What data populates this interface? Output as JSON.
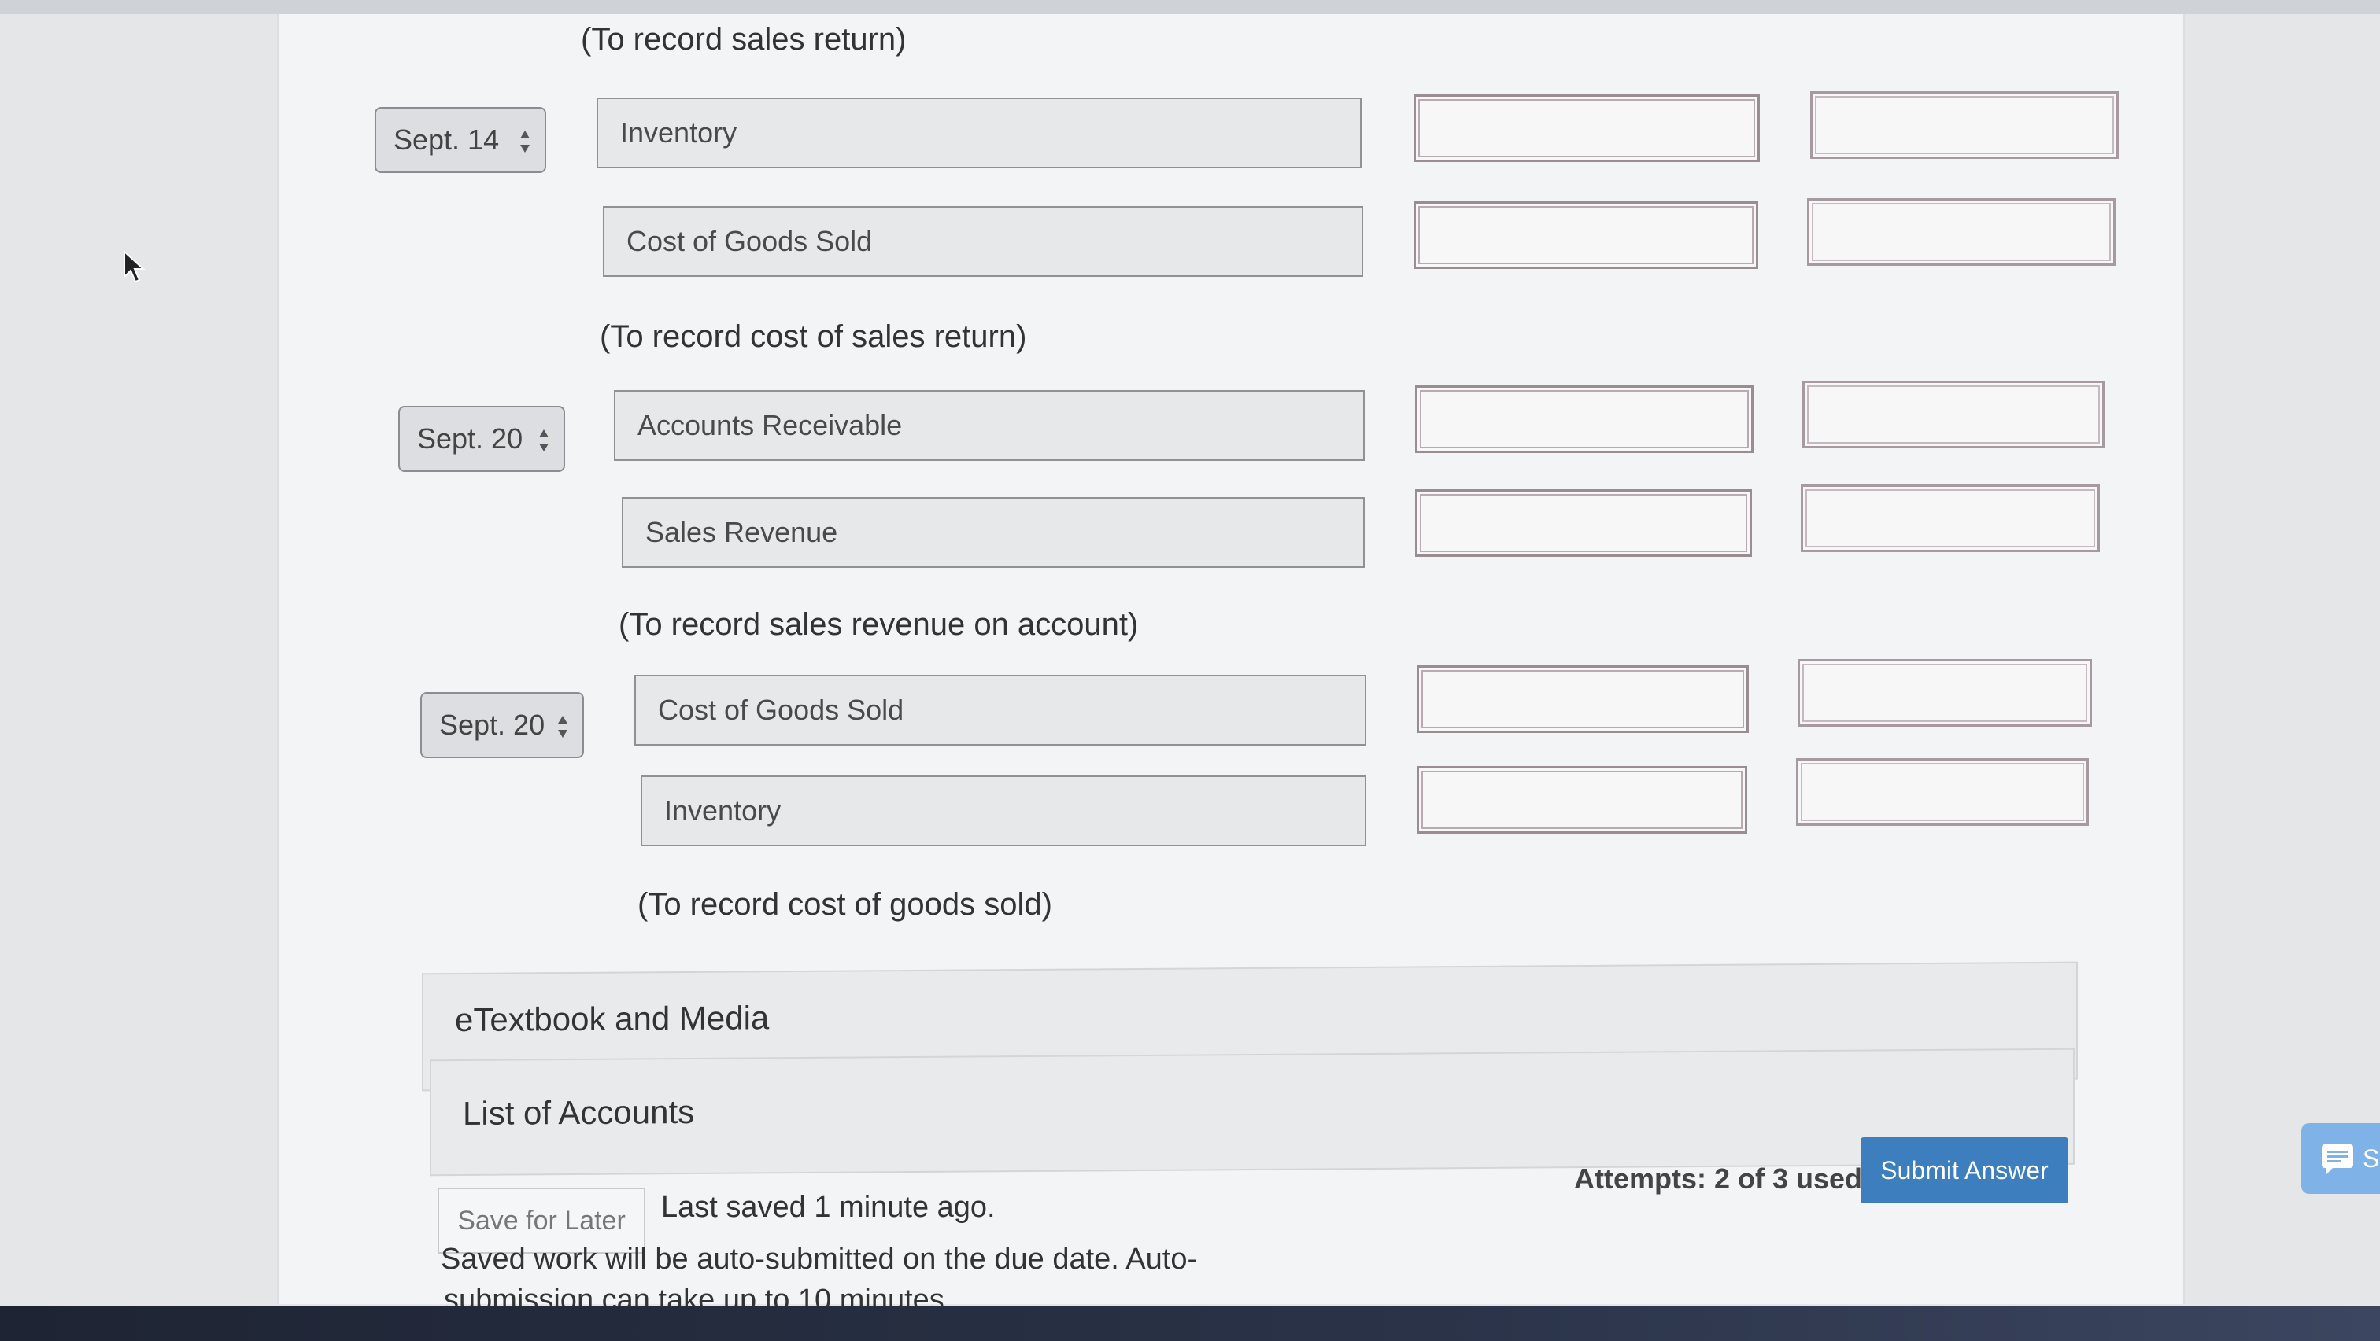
{
  "entries": [
    {
      "caption": "(To record sales return)"
    },
    {
      "date": "Sept. 14",
      "account": "Inventory"
    },
    {
      "account": "Cost of Goods Sold"
    },
    {
      "caption": "(To record cost of sales return)"
    },
    {
      "date": "Sept. 20",
      "account": "Accounts Receivable"
    },
    {
      "account": "Sales Revenue"
    },
    {
      "caption": "(To record sales revenue on account)"
    },
    {
      "date": "Sept. 20",
      "account": "Cost of Goods Sold"
    },
    {
      "account": "Inventory"
    },
    {
      "caption": "(To record cost of goods sold)"
    }
  ],
  "accordions": {
    "etextbook": "eTextbook and Media",
    "accounts": "List of Accounts"
  },
  "footer": {
    "save_label": "Save for Later",
    "last_saved": "Last saved 1 minute ago.",
    "attempts": "Attempts: 2 of 3 used",
    "submit_label": "Submit Answer",
    "note_line1": "Saved work will be auto-submitted on the due date. Auto-",
    "note_line2": "submission can take up to 10 minutes."
  },
  "chat": {
    "label": "S"
  },
  "colors": {
    "accent": "#3d7ebf",
    "chat": "#7fb2e6"
  }
}
